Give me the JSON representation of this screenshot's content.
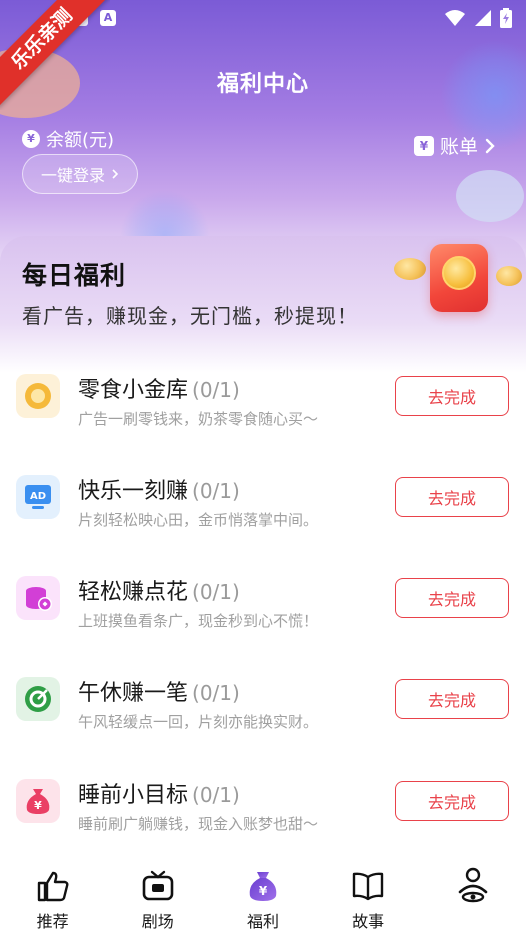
{
  "status_bar": {
    "notification_glyph": "A",
    "icons": [
      "wifi-icon",
      "signal-icon",
      "battery-charging-icon"
    ]
  },
  "ribbon": {
    "text": "乐乐亲测"
  },
  "header": {
    "title": "福利中心",
    "balance_label": "余额(元)",
    "yuan_symbol": "¥",
    "login_button": "一键登录",
    "bill_label": "账单"
  },
  "daily": {
    "title": "每日福利",
    "subtitle": "看广告，赚现金，无门槛，秒提现！"
  },
  "tasks": [
    {
      "title": "零食小金库",
      "progress": "(0/1)",
      "desc": "广告一刷零钱来，奶茶零食随心买～",
      "button": "去完成",
      "icon": "coin-icon",
      "color": "#f5b93a"
    },
    {
      "title": "快乐一刻赚",
      "progress": "(0/1)",
      "desc": "片刻轻松映心田，金币悄落掌中间。",
      "button": "去完成",
      "icon": "ad-icon",
      "color": "#3a8ff0"
    },
    {
      "title": "轻松赚点花",
      "progress": "(0/1)",
      "desc": "上班摸鱼看条广，现金秒到心不慌！",
      "button": "去完成",
      "icon": "coin-stack-icon",
      "color": "#d23fd6"
    },
    {
      "title": "午休赚一笔",
      "progress": "(0/1)",
      "desc": "午风轻缓点一回，片刻亦能换实财。",
      "button": "去完成",
      "icon": "target-icon",
      "color": "#2f9e46"
    },
    {
      "title": "睡前小目标",
      "progress": "(0/1)",
      "desc": "睡前刷广躺赚钱，现金入账梦也甜～",
      "button": "去完成",
      "icon": "money-bag-icon",
      "color": "#ea3f65"
    }
  ],
  "nav": {
    "items": [
      {
        "label": "推荐",
        "icon": "thumbs-up-icon"
      },
      {
        "label": "剧场",
        "icon": "tv-icon"
      },
      {
        "label": "福利",
        "icon": "welfare-bag-icon",
        "active": true
      },
      {
        "label": "故事",
        "icon": "book-icon"
      },
      {
        "label": "",
        "icon": "profile-icon"
      }
    ],
    "welfare_symbol": "¥"
  },
  "colors": {
    "accent_red": "#e9424a",
    "header_purple": "#7b5bd6"
  }
}
